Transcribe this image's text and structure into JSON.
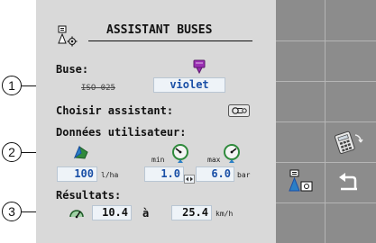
{
  "header": {
    "title": "ASSISTANT BUSES"
  },
  "buse": {
    "label": "Buse:",
    "reference": "ISO 025",
    "value": "violet",
    "color": "#9b2fb4"
  },
  "assistant": {
    "label": "Choisir assistant:"
  },
  "user_data": {
    "label": "Données utilisateur:",
    "flow": {
      "value": "100",
      "unit": "l/ha"
    },
    "pressure": {
      "min_label": "min",
      "max_label": "max",
      "min_value": "1.0",
      "max_value": "6.0",
      "unit": "bar"
    }
  },
  "results": {
    "label": "Résultats:",
    "speed_min": "10.4",
    "separator": "à",
    "speed_max": "25.4",
    "unit": "km/h"
  },
  "callouts": [
    "1",
    "2",
    "3"
  ],
  "colors": {
    "screen_bg": "#d9d9d9",
    "sidebar_bg": "#8c8c8c",
    "field_text": "#1a4fa6",
    "field_bg": "#eef3f8",
    "nozzle_violet": "#9b2fb4",
    "gauge_green": "#2f8a3c"
  },
  "icons": {
    "header": "nozzle-settings-icon",
    "buse": "nozzle-icon",
    "assistant": "assistant-icon",
    "flow": "field-area-icon",
    "pressure_min": "manometer-min-icon",
    "pressure_max": "manometer-max-icon",
    "pressure_link": "link-arrows-icon",
    "speed": "speedometer-icon",
    "sidebar_calculator": "calculator-icon",
    "sidebar_nozzle_settings": "nozzle-settings-icon",
    "sidebar_back": "back-icon"
  }
}
